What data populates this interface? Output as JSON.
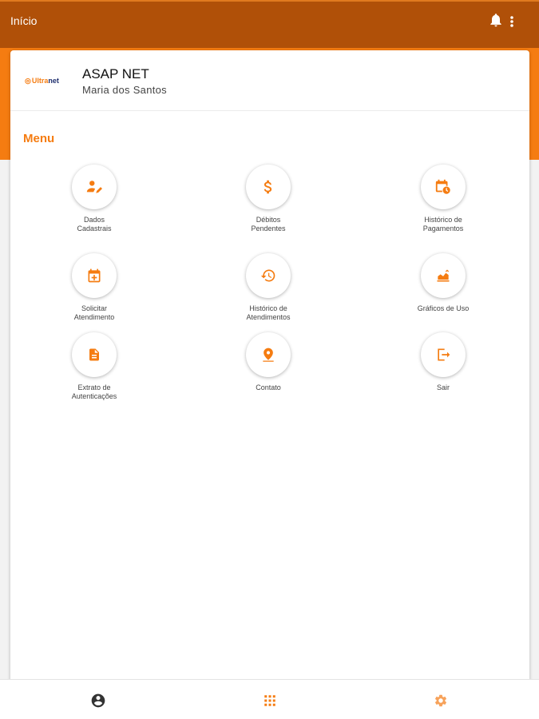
{
  "appbar": {
    "title": "Início",
    "bell_icon": "bell-icon",
    "more_icon": "more-vert-icon"
  },
  "colors": {
    "appbar": "#b05008",
    "accent": "#f57c11",
    "logo_navy": "#1f2f6e"
  },
  "profile": {
    "logo_ultra": "Ultra",
    "logo_net": "net",
    "company": "ASAP NET",
    "user": "Maria dos Santos"
  },
  "menu": {
    "title": "Menu",
    "items": [
      {
        "label": "Dados\nCadastrais",
        "icon": "person-edit-icon"
      },
      {
        "label": "Débitos\nPendentes",
        "icon": "dollar-icon"
      },
      {
        "label": "Histórico de\nPagamentos",
        "icon": "calendar-clock-icon"
      },
      {
        "label": "Solicitar\nAtendimento",
        "icon": "calendar-plus-icon"
      },
      {
        "label": "Histórico de\nAtendimentos",
        "icon": "history-icon"
      },
      {
        "label": "Gráficos de Uso",
        "icon": "area-chart-icon"
      },
      {
        "label": "Extrato de\nAutenticações",
        "icon": "document-icon"
      },
      {
        "label": "Contato",
        "icon": "location-pin-icon"
      },
      {
        "label": "Sair",
        "icon": "logout-icon"
      }
    ]
  },
  "bottom_nav": [
    {
      "icon": "account-circle-icon"
    },
    {
      "icon": "apps-grid-icon"
    },
    {
      "icon": "settings-gear-icon"
    }
  ]
}
